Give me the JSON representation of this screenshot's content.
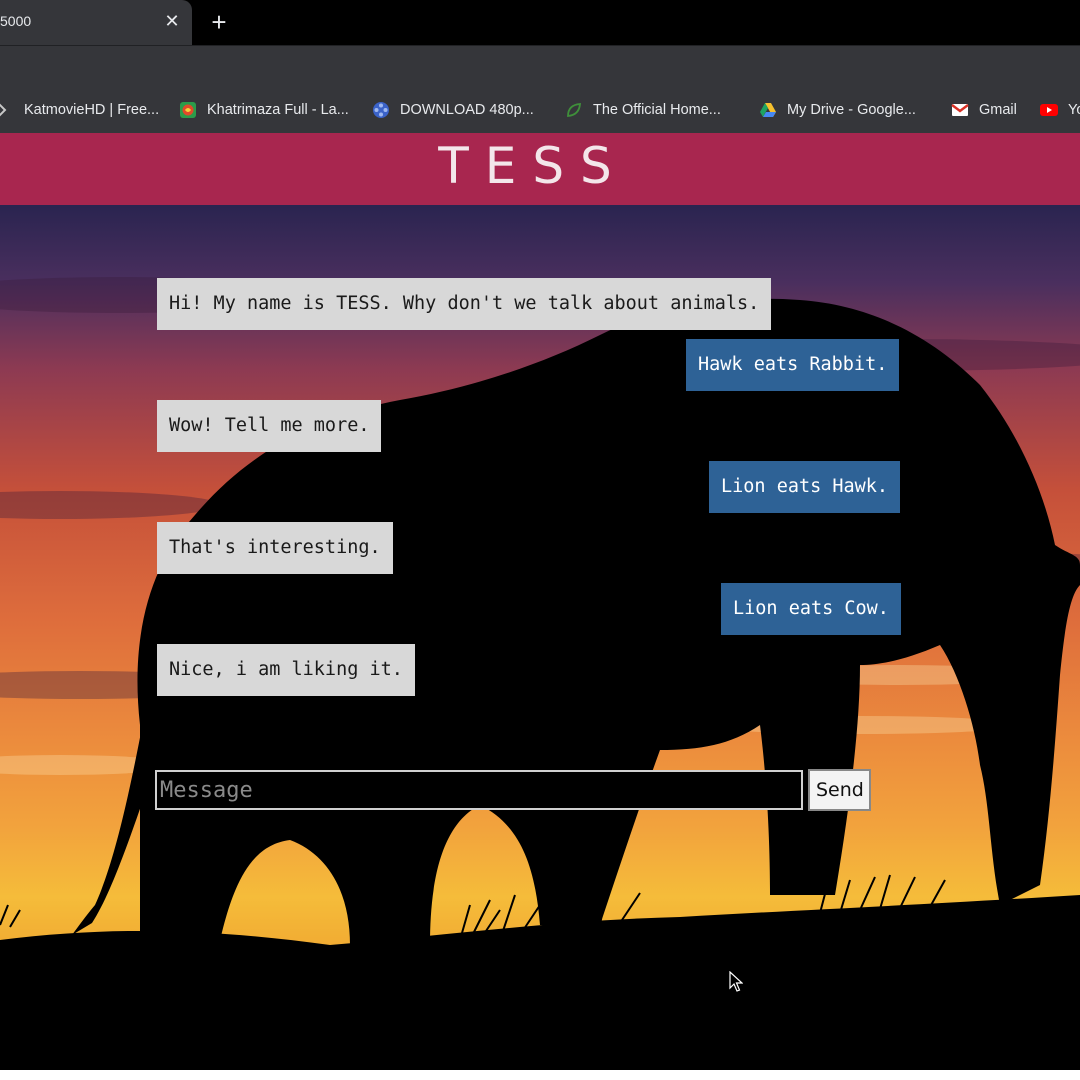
{
  "browser": {
    "tab": {
      "title": "5000",
      "close_glyph": "✕"
    },
    "new_tab_glyph": "+",
    "bookmarks": [
      {
        "label": "KatmovieHD | Free...",
        "icon": "katmovie-icon"
      },
      {
        "label": "Khatrimaza Full - La...",
        "icon": "khatrimaza-icon"
      },
      {
        "label": "DOWNLOAD 480p...",
        "icon": "film-reel-icon"
      },
      {
        "label": "The Official Home...",
        "icon": "leaf-icon"
      },
      {
        "label": "My Drive - Google...",
        "icon": "google-drive-icon"
      },
      {
        "label": "Gmail",
        "icon": "gmail-icon"
      },
      {
        "label": "Yo",
        "icon": "youtube-icon"
      }
    ]
  },
  "app": {
    "title": "TESS",
    "header_color": "#a8264f"
  },
  "chat": {
    "messages": [
      {
        "sender": "bot",
        "text": "Hi! My name is TESS. Why don't we talk about animals."
      },
      {
        "sender": "user",
        "text": "Hawk eats Rabbit."
      },
      {
        "sender": "bot",
        "text": "Wow! Tell me more."
      },
      {
        "sender": "user",
        "text": "Lion eats Hawk."
      },
      {
        "sender": "bot",
        "text": "That's interesting."
      },
      {
        "sender": "user",
        "text": "Lion eats Cow."
      },
      {
        "sender": "bot",
        "text": "Nice, i am liking it."
      }
    ],
    "input": {
      "placeholder": "Message",
      "value": ""
    },
    "send_label": "Send"
  },
  "colors": {
    "bot_bubble": "#d8d8d8",
    "user_bubble": "#2e6296",
    "sunset_top": "#2a2450",
    "sunset_horizon": "#f5bc3a"
  }
}
